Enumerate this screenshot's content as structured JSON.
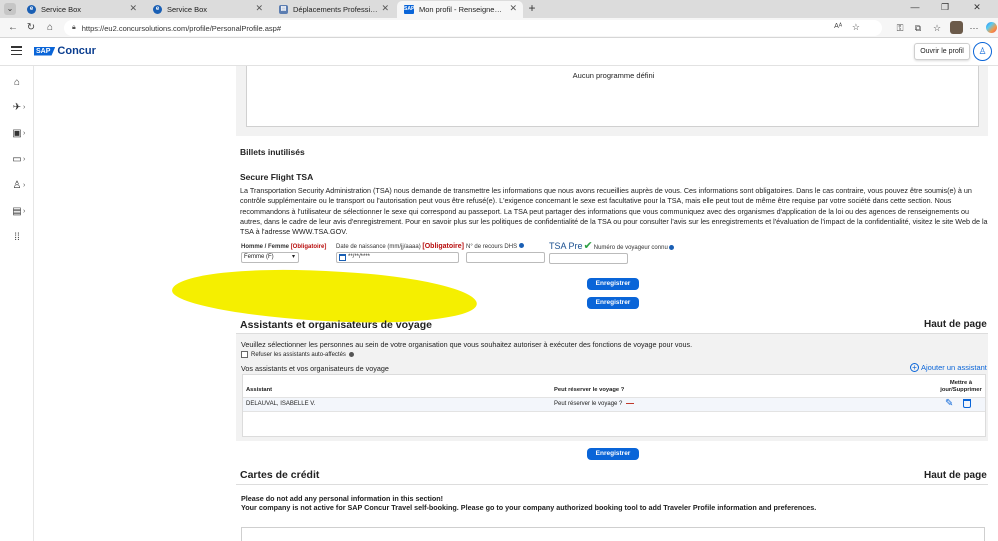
{
  "browser": {
    "tabs": [
      {
        "title": "Service Box",
        "icon": "edge-ie-icon",
        "active": false
      },
      {
        "title": "Service Box",
        "icon": "edge-ie-icon",
        "active": false
      },
      {
        "title": "Déplacements Professionnels - Tr",
        "icon": "page-icon",
        "active": false
      },
      {
        "title": "Mon profil - Renseignements per",
        "icon": "sap-icon",
        "active": true
      }
    ],
    "new_tab": "+",
    "url": "https://eu2.concursolutions.com/profile/PersonalProfile.asp#",
    "read_aloud": "Aᴬ"
  },
  "header": {
    "logo_sap": "SAP",
    "logo_product": "Concur",
    "tooltip": "Ouvrir le profil"
  },
  "loyalty": {
    "empty_text": "Aucun programme défini"
  },
  "unused_tickets": {
    "title": "Billets inutilisés"
  },
  "secure_flight": {
    "title": "Secure Flight TSA",
    "paragraph": "La Transportation Security Administration (TSA) nous demande de transmettre les informations que nous avons recueillies auprès de vous. Ces informations sont obligatoires. Dans le cas contraire, vous pouvez être soumis(e) à un contrôle supplémentaire ou le transport ou l'autorisation peut vous être refusé(e). L'exigence concernant le sexe est facultative pour la TSA, mais elle peut tout de même être requise par votre société dans cette section. Nous recommandons à l'utilisateur de sélectionner le sexe qui correspond au passeport. La TSA peut partager des informations que vous communiquez avec des organismes d'application de la loi ou des agences de renseignements ou autres, dans le cadre de leur avis d'enregistrement. Pour en savoir plus sur les politiques de confidentialité de la TSA ou pour consulter l'avis sur les enregistrements et l'évaluation de l'impact de la confidentialité, visitez le site Web de la TSA à l'adresse WWW.TSA.GOV.",
    "gender_label": "Homme / Femme",
    "required_tag": "[Obligatoire]",
    "gender_value": "Femme (F)",
    "dob_label": "Date de naissance (mm/jj/aaaa)",
    "dob_required_tag": "[Obligatoire]",
    "dob_value": "**/**/****",
    "dhs_label": "N° de recours DHS",
    "tsa_pre": "TSA Pre",
    "ktn_label": "Numéro de voyageur connu",
    "save_label": "Enregistrer",
    "save_label_2": "Enregistrer"
  },
  "assistants": {
    "title": "Assistants et organisateurs de voyage",
    "top_link": "Haut de page",
    "description": "Veuillez sélectionner les personnes au sein de votre organisation que vous souhaitez autoriser à exécuter des fonctions de voyage pour vous.",
    "refuse_checkbox": "Refuser les assistants auto-affectés",
    "list_title": "Vos assistants et vos organisateurs de voyage",
    "add_link": "Ajouter un assistant",
    "columns": [
      "Assistant",
      "Peut réserver le voyage ?",
      "Mettre à jour/Supprimer"
    ],
    "rows": [
      {
        "name": "DELAUVAL, ISABELLE V.",
        "can_book": "Peut réserver le voyage ?"
      }
    ],
    "save_label": "Enregistrer"
  },
  "credit_cards": {
    "title": "Cartes de crédit",
    "top_link": "Haut de page",
    "warning_1": "Please do not add any personal information in this section!",
    "warning_2": "Your company is not active for SAP Concur Travel self-booking. Please go to your company authorized booking tool to add Traveler Profile information and preferences."
  },
  "colors": {
    "accent": "#0a65d8",
    "required": "#b80d0d",
    "highlight": "#f5ef00"
  }
}
